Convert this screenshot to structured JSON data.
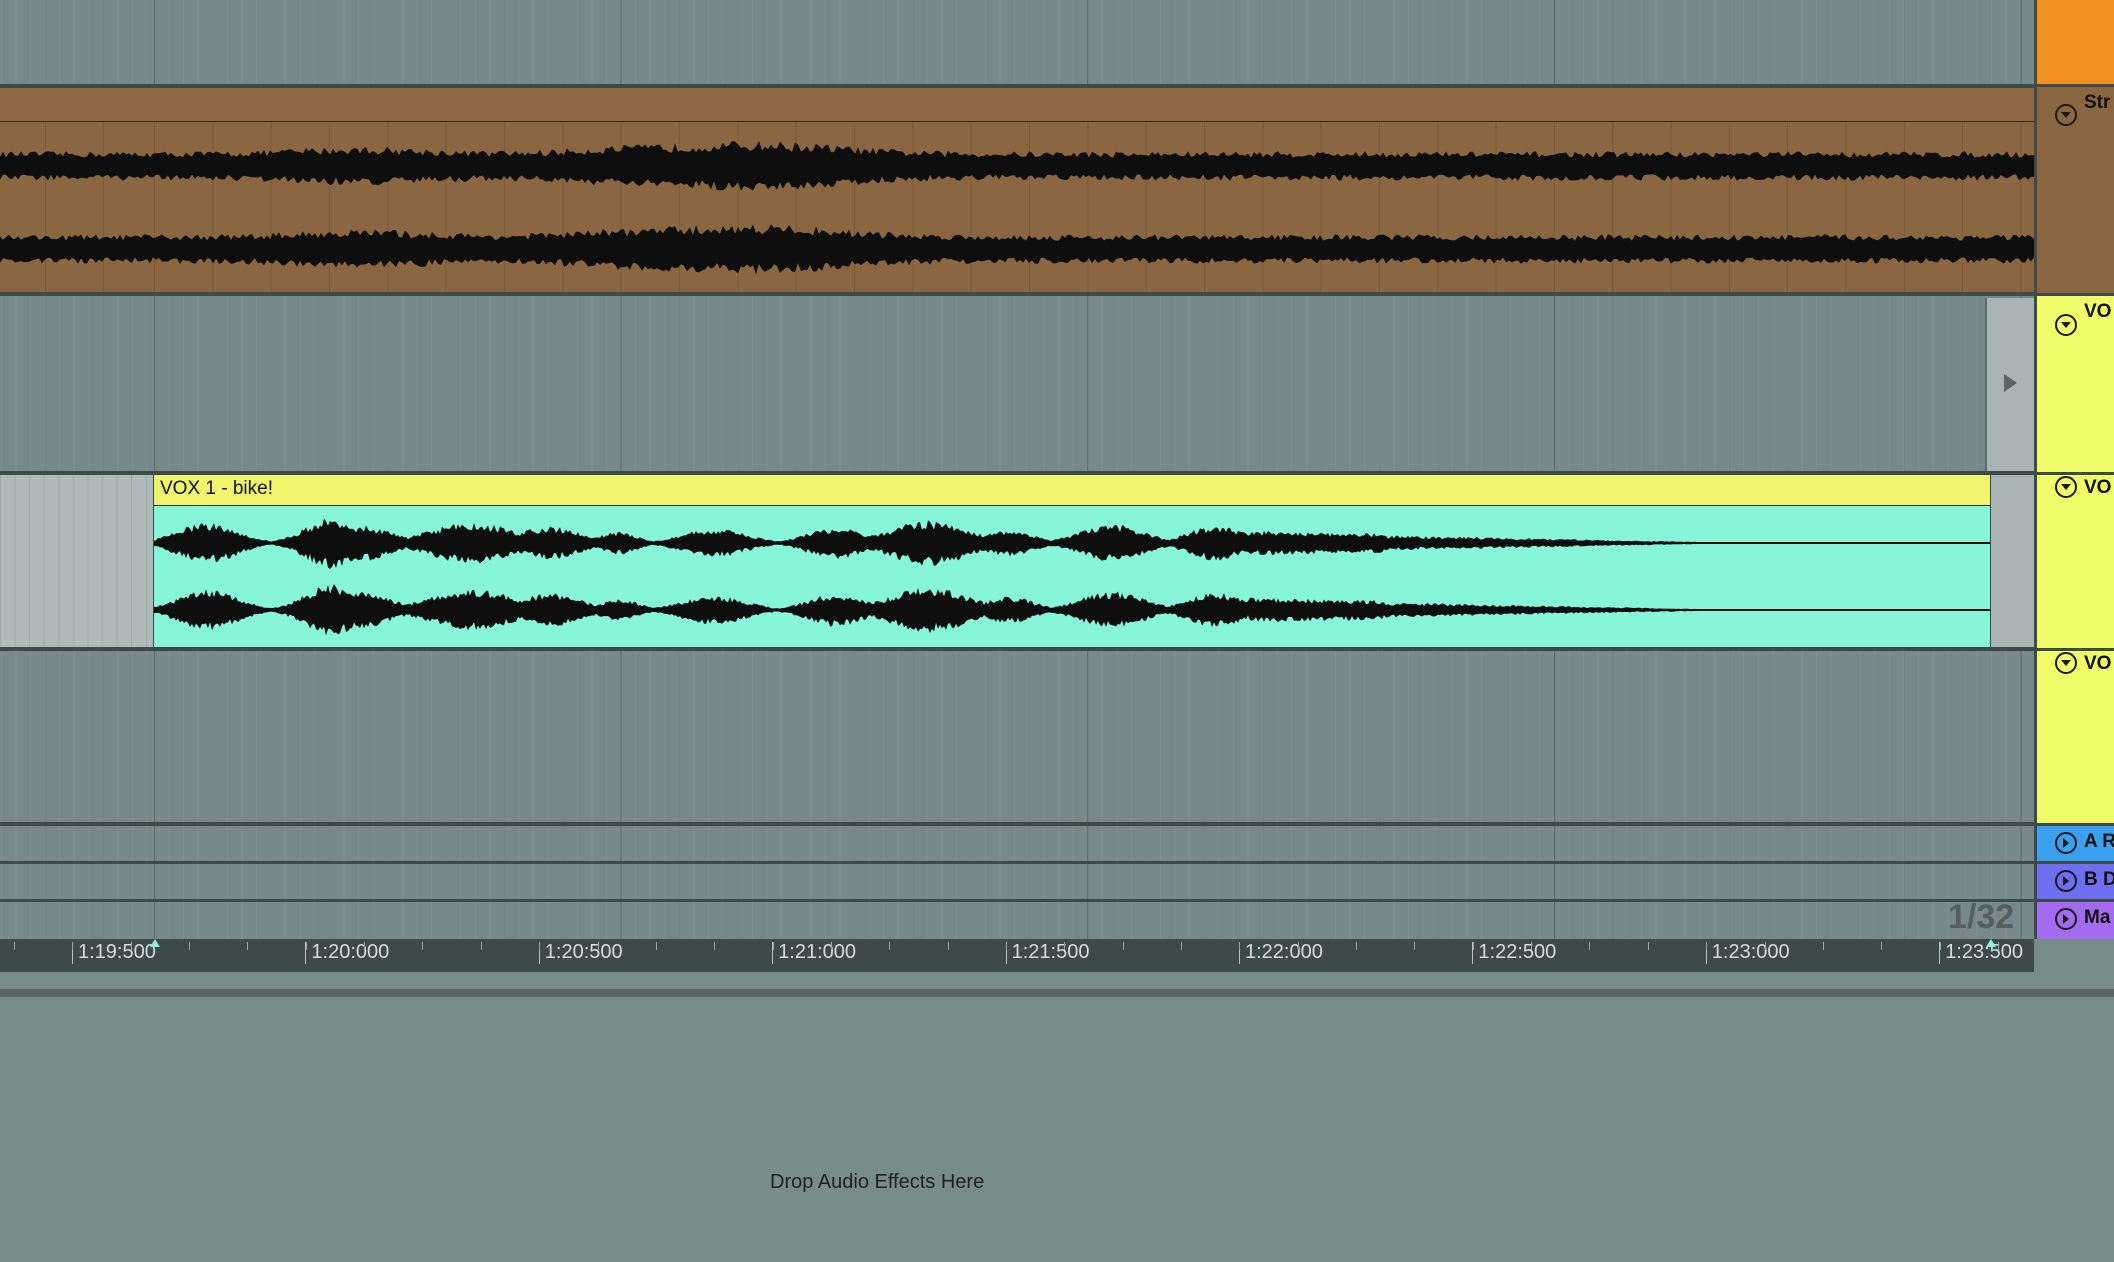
{
  "tracks": [
    {
      "id": "strings",
      "header_label": "Str",
      "color": "#f39022"
    },
    {
      "id": "vox-a",
      "header_label": "VO",
      "color": "#f1fc6a"
    },
    {
      "id": "vox-b",
      "header_label": "VO",
      "color": "#f1fc6a"
    },
    {
      "id": "vox-c",
      "header_label": "VO",
      "color": "#f1fc6a"
    }
  ],
  "return_tracks": [
    {
      "label": "A R",
      "color": "#3aa1f0"
    },
    {
      "label": "B D",
      "color": "#6e6ef0"
    }
  ],
  "master_track": {
    "label": "Ma",
    "color": "#a36cf0"
  },
  "clips": {
    "strings": {
      "color": "#8a6641"
    },
    "vox": {
      "name": "VOX 1 - bike!",
      "header_color": "#f0f46c",
      "body_color": "#86f5d8"
    }
  },
  "zoom_indicator": "1/32",
  "time_ruler": [
    "1:19:500",
    "1:20:000",
    "1:20:500",
    "1:21:000",
    "1:21:500",
    "1:22:000",
    "1:22:500",
    "1:23:000",
    "1:23:500"
  ],
  "device_view": {
    "drop_hint": "Drop Audio Effects Here"
  }
}
